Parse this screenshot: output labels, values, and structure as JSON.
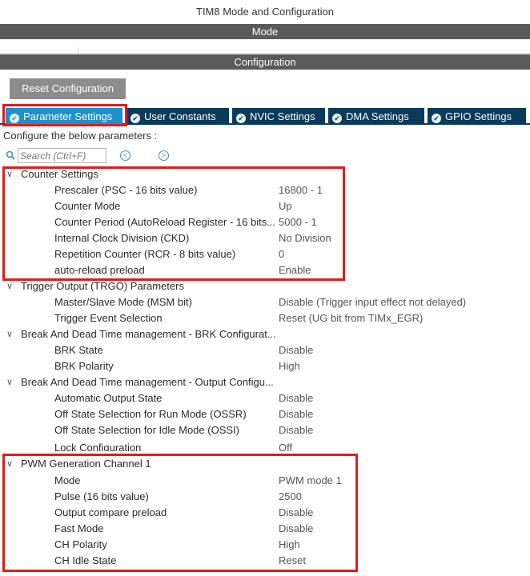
{
  "window": {
    "title": "TIM8 Mode and Configuration"
  },
  "sections": {
    "mode": "Mode",
    "configuration": "Configuration"
  },
  "reset_button": "Reset Configuration",
  "tabs": [
    {
      "label": "Parameter Settings",
      "active": true
    },
    {
      "label": "User Constants",
      "active": false
    },
    {
      "label": "NVIC Settings",
      "active": false
    },
    {
      "label": "DMA Settings",
      "active": false
    },
    {
      "label": "GPIO Settings",
      "active": false
    }
  ],
  "configure_label": "Configure the below parameters :",
  "search": {
    "placeholder": "Search (Ctrl+F)"
  },
  "groups": [
    {
      "label": "Counter Settings",
      "params": [
        {
          "name": "Prescaler (PSC - 16 bits value)",
          "value": "16800 - 1"
        },
        {
          "name": "Counter Mode",
          "value": "Up"
        },
        {
          "name": "Counter Period (AutoReload Register - 16 bits...",
          "value": "5000 - 1"
        },
        {
          "name": "Internal Clock Division (CKD)",
          "value": "No Division"
        },
        {
          "name": "Repetition Counter (RCR - 8 bits value)",
          "value": "0"
        },
        {
          "name": "auto-reload preload",
          "value": "Enable"
        }
      ]
    },
    {
      "label": "Trigger Output (TRGO) Parameters",
      "params": [
        {
          "name": "Master/Slave Mode (MSM bit)",
          "value": "Disable (Trigger input effect not delayed)"
        },
        {
          "name": "Trigger Event Selection",
          "value": "Reset (UG bit from TIMx_EGR)"
        }
      ]
    },
    {
      "label": "Break And Dead Time management - BRK Configurat...",
      "params": [
        {
          "name": "BRK State",
          "value": "Disable"
        },
        {
          "name": "BRK Polarity",
          "value": "High"
        }
      ]
    },
    {
      "label": "Break And Dead Time management - Output Configu...",
      "params": [
        {
          "name": "Automatic Output State",
          "value": "Disable"
        },
        {
          "name": "Off State Selection for Run Mode (OSSR)",
          "value": "Disable"
        },
        {
          "name": "Off State Selection for Idle Mode (OSSI)",
          "value": "Disable"
        },
        {
          "name": "Lock Configuration",
          "value": "Off"
        }
      ]
    },
    {
      "label": "PWM Generation Channel 1",
      "params": [
        {
          "name": "Mode",
          "value": "PWM mode 1"
        },
        {
          "name": "Pulse (16 bits value)",
          "value": "2500"
        },
        {
          "name": "Output compare preload",
          "value": "Disable"
        },
        {
          "name": "Fast Mode",
          "value": "Disable"
        },
        {
          "name": "CH Polarity",
          "value": "High"
        },
        {
          "name": "CH Idle State",
          "value": "Reset"
        }
      ]
    }
  ],
  "colors": {
    "highlight": "#e21b1b",
    "tab_active": "#1e90cc",
    "tab_inactive": "#0b3a5c",
    "section_bar": "#5a5a5a"
  }
}
